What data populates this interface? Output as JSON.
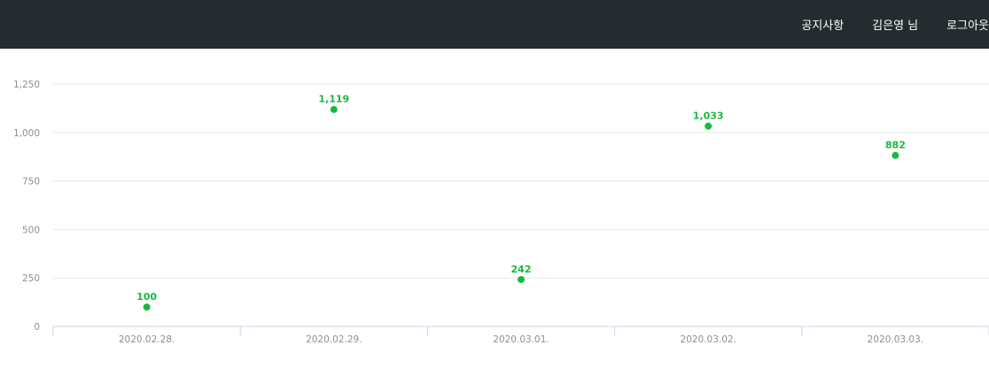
{
  "header": {
    "nav": {
      "notice": "공지사항",
      "user": "김은영 님",
      "logout": "로그아웃"
    }
  },
  "colors": {
    "header_bg": "#252c30",
    "series": "#17b93f",
    "grid": "#e6e9ee",
    "axis": "#c9d3e8",
    "tick_text": "#8b8f94"
  },
  "chart_data": {
    "type": "scatter",
    "categories": [
      "2020.02.28.",
      "2020.02.29.",
      "2020.03.01.",
      "2020.03.02.",
      "2020.03.03."
    ],
    "values": [
      100,
      1119,
      242,
      1033,
      882
    ],
    "value_labels": [
      "100",
      "1,119",
      "242",
      "1,033",
      "882"
    ],
    "ylim": [
      0,
      1250
    ],
    "yticks": [
      0,
      250,
      500,
      750,
      1000,
      1250
    ],
    "ytick_labels": [
      "0",
      "250",
      "500",
      "750",
      "1,000",
      "1,250"
    ],
    "grid": true,
    "legend": false
  }
}
